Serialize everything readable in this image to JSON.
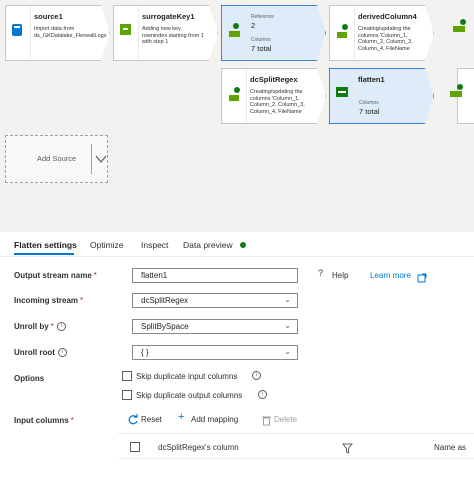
{
  "canvas": {
    "nodes": {
      "source1": {
        "title": "source1",
        "desc": "Import data from ds_GKDatalake_FlerwallLogs"
      },
      "surrogateKey1": {
        "title": "surrogateKey1",
        "desc": "Adding new key rownindex starting from 1 with step 1"
      },
      "split_ref": {
        "ref_label": "Reference",
        "ref_value": "2",
        "col_label": "Columns",
        "col_value": "7 total"
      },
      "derivedColumn4": {
        "title": "derivedColumn4",
        "desc": "Creating/updating the columns 'Column_1, Column_2, Column_3, Column_4, FileName"
      },
      "dcSplitRegex": {
        "title": "dcSplitRegex",
        "desc": "Creating/updating the columns 'Column_1, Column_2, Column_3, Column_4, FileName"
      },
      "flatten1": {
        "title": "flatten1",
        "col_label": "Columns",
        "col_value": "7 total"
      }
    },
    "add_source": "Add Source"
  },
  "tabs": [
    {
      "label": "Flatten settings"
    },
    {
      "label": "Optimize"
    },
    {
      "label": "Inspect"
    },
    {
      "label": "Data preview"
    }
  ],
  "status_color": "#107c10",
  "accent": "#0078d4",
  "form": {
    "output_stream_label": "Output stream name",
    "output_stream_value": "flatten1",
    "help": "Help",
    "learn_more": "Learn more",
    "incoming_label": "Incoming stream",
    "incoming_value": "dcSplitRegex",
    "unroll_by_label": "Unroll by",
    "unroll_by_value": "SplitBySpace",
    "unroll_root_label": "Unroll root",
    "unroll_root_value": "{ }",
    "options_label": "Options",
    "skip_input": "Skip duplicate input columns",
    "skip_output": "Skip duplicate output columns",
    "input_columns_label": "Input columns",
    "reset": "Reset",
    "add_mapping": "Add mapping",
    "delete": "Delete",
    "col_header_source": "dcSplitRegex's column",
    "col_header_name": "Name as",
    "required_mark": "*"
  }
}
